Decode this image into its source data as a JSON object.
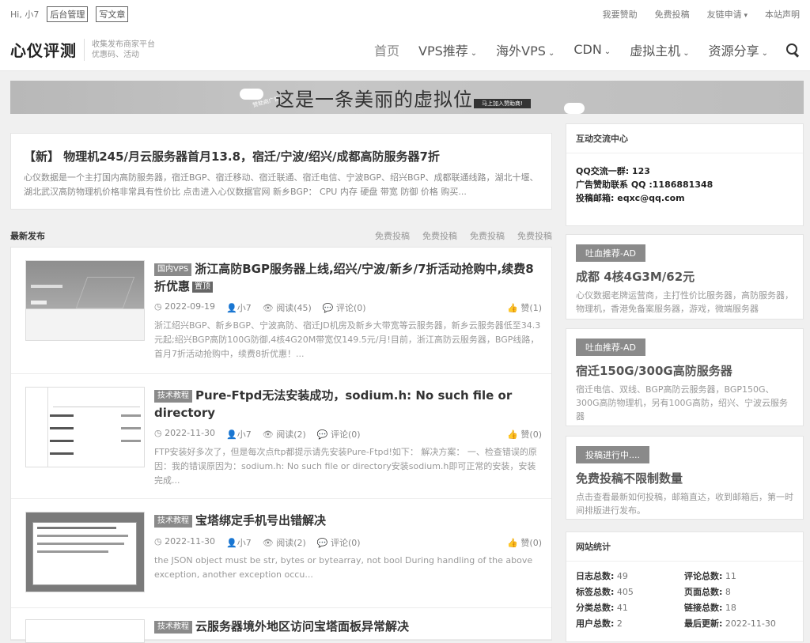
{
  "topbar": {
    "greeting": "Hi, 小7",
    "admin": "后台管理",
    "write": "写文章",
    "links": [
      "我要赞助",
      "免费投稿",
      "友链申请",
      "本站声明"
    ]
  },
  "header": {
    "logo": "心仪评测",
    "tagline1": "收集发布商家平台",
    "tagline2": "优惠码、活动",
    "nav": [
      "首页",
      "VPS推荐",
      "海外VPS",
      "CDN",
      "虚拟主机",
      "资源分享"
    ]
  },
  "banner": {
    "text": "这是一条美丽的虚拟位",
    "button": "马上加入赞助商!",
    "stamp": "赞助商广告"
  },
  "featured": {
    "title": "【新】 物理机245/月云服务器首月13.8，宿迁/宁波/绍兴/成都高防服务器7折",
    "excerpt": "心仪数据是一个主打国内高防服务器，宿迁BGP、宿迁移动、宿迁联通、宿迁电信、宁波BGP、绍兴BGP、成都联通线路，湖北十堰、湖北武汉高防物理机价格非常具有性价比 点击进入心仪数据官网 新乡BGP： CPU 内存 硬盘 带宽 防御 价格 购买..."
  },
  "section": {
    "title": "最新发布",
    "links": [
      "免费投稿",
      "免费投稿",
      "免费投稿",
      "免费投稿"
    ]
  },
  "posts": [
    {
      "tag": "国内VPS",
      "title": "浙江高防BGP服务器上线,绍兴/宁波/新乡/7折活动抢购中,续费8折优惠",
      "badge": "置顶",
      "date": "2022-09-19",
      "author": "小7",
      "reads": "阅读(45)",
      "comments": "评论(0)",
      "likes": "赞(1)",
      "excerpt": "浙江绍兴BGP、新乡BGP、宁波高防、宿迁JD机房及新乡大带宽等云服务器，新乡云服务器低至34.3元起;绍兴BGP高防100G防御,4核4G20M带宽仅149.5元/月!目前，浙江高防云服务器，BGP线路，首月7折活动抢购中，续费8折优惠！..."
    },
    {
      "tag": "技术教程",
      "title": "Pure-Ftpd无法安装成功，sodium.h: No such file or directory",
      "badge": "",
      "date": "2022-11-30",
      "author": "小7",
      "reads": "阅读(2)",
      "comments": "评论(0)",
      "likes": "赞(0)",
      "excerpt": "FTP安装好多次了，但是每次点ftp都提示请先安装Pure-Ftpd!如下： 解决方案： 一、检查错误的原因：我的错误原因为：sodium.h: No such file or directory安装sodium.h即可正常的安装，安装完成..."
    },
    {
      "tag": "技术教程",
      "title": "宝塔绑定手机号出错解决",
      "badge": "",
      "date": "2022-11-30",
      "author": "小7",
      "reads": "阅读(2)",
      "comments": "评论(0)",
      "likes": "赞(0)",
      "excerpt": "the JSON object must be str, bytes or bytearray, not bool During handling of the above exception, another exception occu..."
    },
    {
      "tag": "技术教程",
      "title": "云服务器境外地区访问宝塔面板异常解决",
      "badge": "",
      "date": "",
      "author": "",
      "reads": "",
      "comments": "",
      "likes": "",
      "excerpt": ""
    }
  ],
  "sidebar": {
    "contact": {
      "title": "互动交流中心",
      "lines": [
        "QQ交流一群: 123",
        "广告赞助联系 QQ :1186881348",
        "投稿邮箱:  eqxc@qq.com"
      ]
    },
    "ads": [
      {
        "label": "吐血推荐-AD",
        "title": "成都 4核4G3M/62元",
        "desc": "心仪数据老牌运营商，主打性价比服务器，高防服务器，物理机，香港免备案服务器，游戏，微端服务器"
      },
      {
        "label": "吐血推荐-AD",
        "title": "宿迁150G/300G高防服务器",
        "desc": "宿迁电信、双线、BGP高防云服务器，BGP150G、300G高防物理机，另有100G高防，绍兴、宁波云服务器"
      },
      {
        "label": "投稿进行中....",
        "title": "免费投稿不限制数量",
        "desc": "点击查看最新如何投稿，邮箱直达，收到邮箱后，第一时间排版进行发布。"
      }
    ],
    "stats": {
      "title": "网站统计",
      "items": [
        {
          "k": "日志总数:",
          "v": "49"
        },
        {
          "k": "评论总数:",
          "v": "11"
        },
        {
          "k": "标签总数:",
          "v": "405"
        },
        {
          "k": "页面总数:",
          "v": "8"
        },
        {
          "k": "分类总数:",
          "v": "41"
        },
        {
          "k": "链接总数:",
          "v": "18"
        },
        {
          "k": "用户总数:",
          "v": "2"
        },
        {
          "k": "最后更新:",
          "v": "2022-11-30"
        }
      ]
    }
  }
}
